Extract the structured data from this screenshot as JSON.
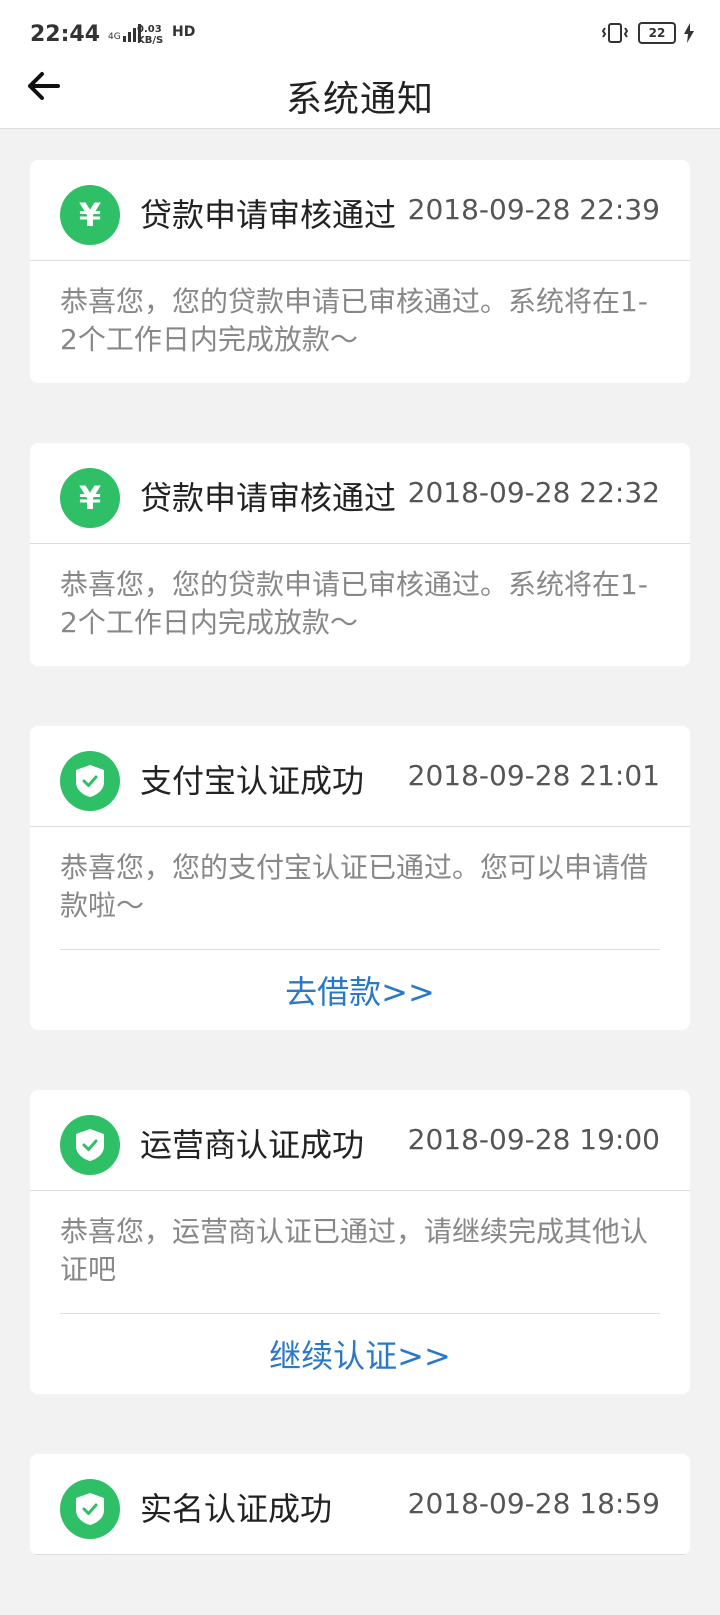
{
  "status": {
    "time": "22:44",
    "network": "4G",
    "speed_value": "0.03",
    "speed_unit": "KB/S",
    "hd": "HD",
    "battery": "22"
  },
  "header": {
    "title": "系统通知"
  },
  "colors": {
    "accent_green": "#2fbf66",
    "link_blue": "#2a78c8"
  },
  "notifications": [
    {
      "icon": "yen-icon",
      "title": "贷款申请审核通过",
      "time": "2018-09-28 22:39",
      "body": "恭喜您，您的贷款申请已审核通过。系统将在1-2个工作日内完成放款～"
    },
    {
      "icon": "yen-icon",
      "title": "贷款申请审核通过",
      "time": "2018-09-28 22:32",
      "body": "恭喜您，您的贷款申请已审核通过。系统将在1-2个工作日内完成放款～"
    },
    {
      "icon": "shield-check-icon",
      "title": "支付宝认证成功",
      "time": "2018-09-28 21:01",
      "body": "恭喜您，您的支付宝认证已通过。您可以申请借款啦～",
      "action": "去借款>>"
    },
    {
      "icon": "shield-check-icon",
      "title": "运营商认证成功",
      "time": "2018-09-28 19:00",
      "body": "恭喜您，运营商认证已通过，请继续完成其他认证吧",
      "action": "继续认证>>"
    },
    {
      "icon": "shield-check-icon",
      "title": "实名认证成功",
      "time": "2018-09-28 18:59"
    }
  ]
}
